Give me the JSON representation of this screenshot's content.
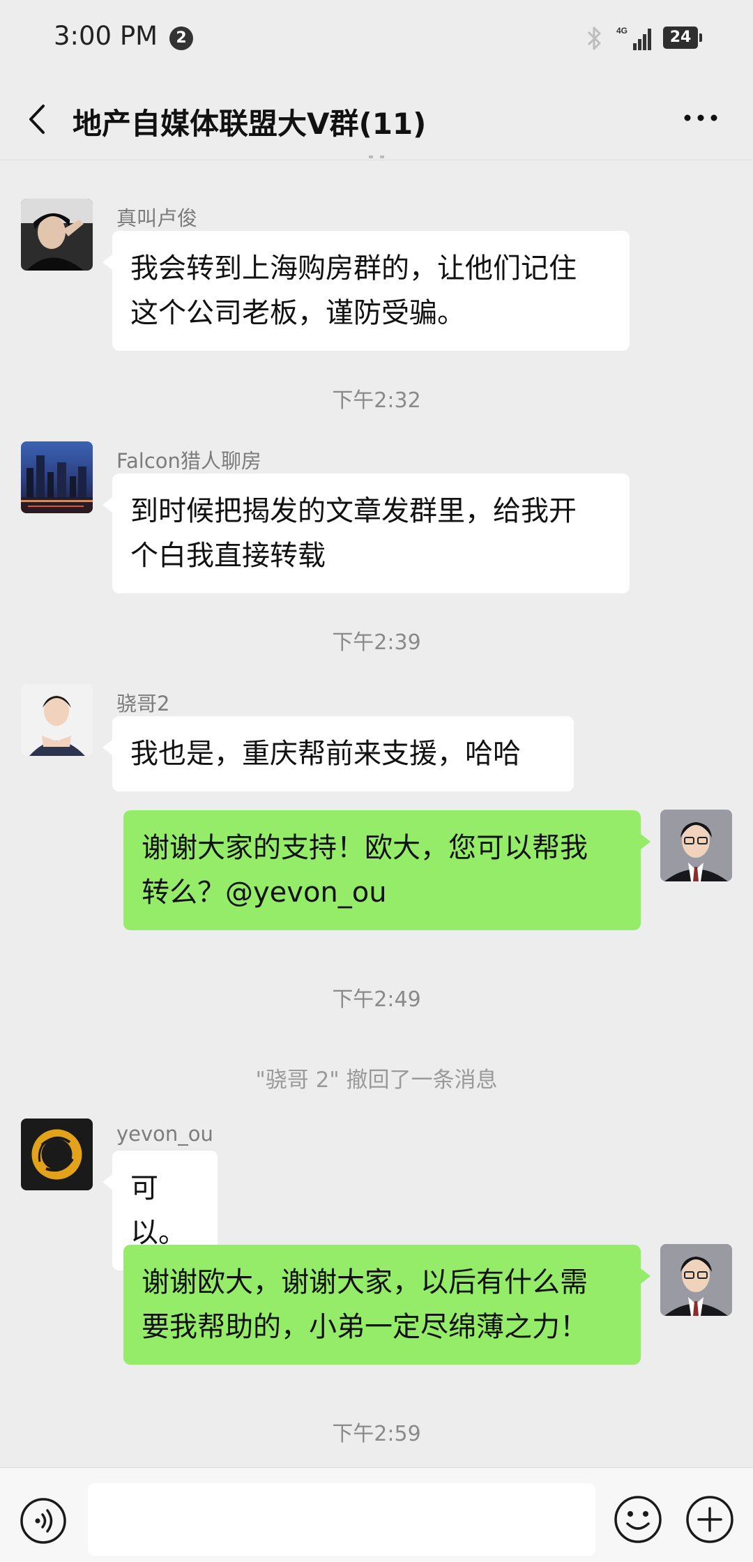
{
  "status_bar": {
    "time": "3:00 PM",
    "notification_count": "2",
    "network_label": "4G",
    "battery": "24",
    "icons": [
      "bluetooth-icon",
      "signal-icon",
      "battery-icon"
    ]
  },
  "header": {
    "title": "地产自媒体联盟大V群(11)",
    "back_icon": "chevron-left-icon",
    "more_icon": "more-dots-icon"
  },
  "messages": [
    {
      "sender": "真叫卢俊",
      "side": "left",
      "text": [
        "我会转到上海购房群的，让他们记住",
        "这个公司老板，谨防受骗。"
      ]
    },
    {
      "sender": "Falcon猎人聊房",
      "side": "left",
      "text": [
        "到时候把揭发的文章发群里，给我开",
        "个白我直接转载"
      ]
    },
    {
      "sender": "骁哥2",
      "side": "left",
      "text": [
        "我也是，重庆帮前来支援，哈哈"
      ]
    },
    {
      "side": "right",
      "text": [
        "谢谢大家的支持！欧大，您可以帮我",
        "转么？@yevon_ou"
      ]
    },
    {
      "sender": "yevon_ou",
      "side": "left",
      "text": [
        "可以。"
      ]
    },
    {
      "side": "right",
      "text": [
        "谢谢欧大，谢谢大家，以后有什么需",
        "要我帮助的，小弟一定尽绵薄之力！"
      ]
    }
  ],
  "timestamps": [
    "下午2:32",
    "下午2:39",
    "下午2:49",
    "下午2:59"
  ],
  "system_notice": "\"骁哥 2\" 撤回了一条消息",
  "input_bar": {
    "voice_icon": "voice-icon",
    "emoji_icon": "emoji-icon",
    "add_icon": "plus-icon"
  },
  "colors": {
    "background": "#ededed",
    "bubble_self": "#95ec69",
    "bubble_other": "#ffffff"
  }
}
